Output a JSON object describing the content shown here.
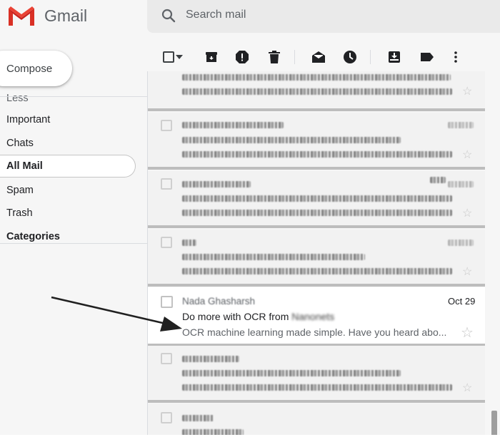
{
  "brand": {
    "name": "Gmail"
  },
  "search": {
    "placeholder": "Search mail"
  },
  "sidebar": {
    "compose_label": "Compose",
    "items": [
      {
        "label": "Less"
      },
      {
        "label": "Important"
      },
      {
        "label": "Chats"
      },
      {
        "label": "All Mail"
      },
      {
        "label": "Spam"
      },
      {
        "label": "Trash"
      },
      {
        "label": "Categories"
      }
    ],
    "active_item": "All Mail"
  },
  "toolbar": {
    "icons": [
      "select-checkbox",
      "select-dropdown",
      "archive-icon",
      "report-spam-icon",
      "delete-icon",
      "mark-read-icon",
      "snooze-icon",
      "move-to-icon",
      "label-icon",
      "more-options-icon"
    ]
  },
  "highlighted_email": {
    "sender": "Nada Ghasharsh",
    "date": "Oct 29",
    "subject": "Do more with OCR from ",
    "subject_redacted": "Nanonets",
    "preview": "OCR machine learning made simple. Have you heard abo..."
  },
  "colors": {
    "gmail_red": "#ea4335",
    "active_nav_bg": "#ffffff",
    "icon_gray": "#202124"
  }
}
